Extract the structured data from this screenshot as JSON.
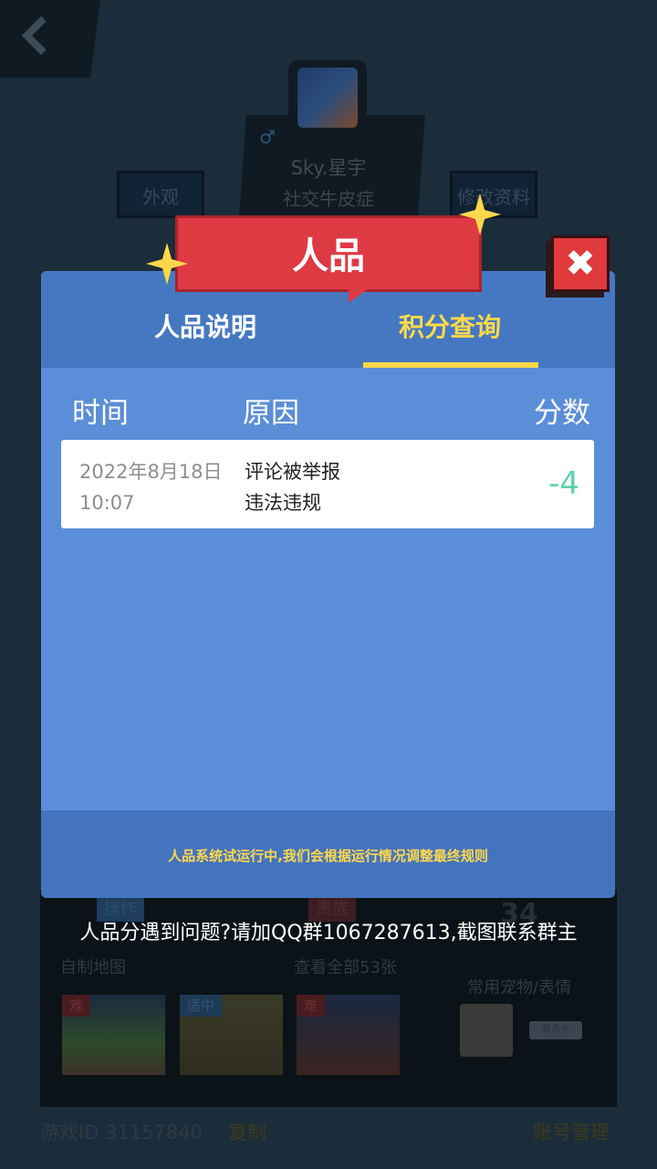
{
  "background": {
    "profile": {
      "nickname": "Sky.星宇",
      "signature": "社交牛皮症",
      "appearance_label": "外观",
      "edit_profile_label": "修改资料"
    },
    "stats": {
      "tag_operation": "操作",
      "tag_noble": "贵族",
      "number": "34"
    },
    "maps": {
      "label": "自制地图",
      "view_all": "查看全部53张",
      "items": [
        {
          "difficulty": "难"
        },
        {
          "difficulty": "适中"
        },
        {
          "difficulty": "难"
        }
      ]
    },
    "pets": {
      "label": "常用宠物/表情",
      "button": "有点卡"
    },
    "footer": {
      "game_id": "游戏ID 31157840",
      "copy": "复制",
      "account_manage": "账号管理"
    }
  },
  "qq_note": "人品分遇到问题?请加QQ群1067287613,截图联系群主",
  "modal": {
    "title": "人品",
    "tabs": [
      {
        "label": "人品说明",
        "active": false
      },
      {
        "label": "积分查询",
        "active": true
      }
    ],
    "columns": {
      "time": "时间",
      "reason": "原因",
      "score": "分数"
    },
    "rows": [
      {
        "date": "2022年8月18日",
        "time": "10:07",
        "reason_line1": "评论被举报",
        "reason_line2": "违法违规",
        "score": "-4"
      }
    ],
    "footer_note": "人品系统试运行中,我们会根据运行情况调整最终规则",
    "close_icon": "close-icon"
  },
  "colors": {
    "accent_yellow": "#ffd84a",
    "ribbon_red": "#de3a44",
    "modal_blue": "#5b8ed8",
    "score_green": "#5fd1a8"
  }
}
